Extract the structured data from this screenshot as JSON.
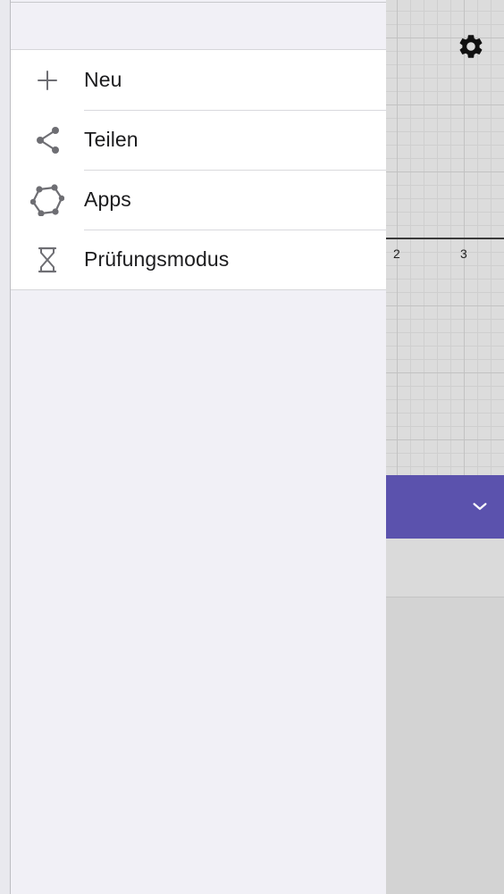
{
  "menu": {
    "items": [
      {
        "label": "Neu",
        "icon": "plus-icon"
      },
      {
        "label": "Teilen",
        "icon": "share-icon"
      },
      {
        "label": "Apps",
        "icon": "apps-icon"
      },
      {
        "label": "Prüfungsmodus",
        "icon": "hourglass-icon"
      }
    ]
  },
  "graph": {
    "x_ticks": [
      "2",
      "3"
    ]
  },
  "colors": {
    "accent": "#5b52ad",
    "menu_background": "#f1f0f6",
    "menu_list_background": "#ffffff",
    "icon_gray": "#6e6e73"
  },
  "icons": {
    "settings": "gear-icon",
    "collapse": "chevron-down-icon"
  }
}
